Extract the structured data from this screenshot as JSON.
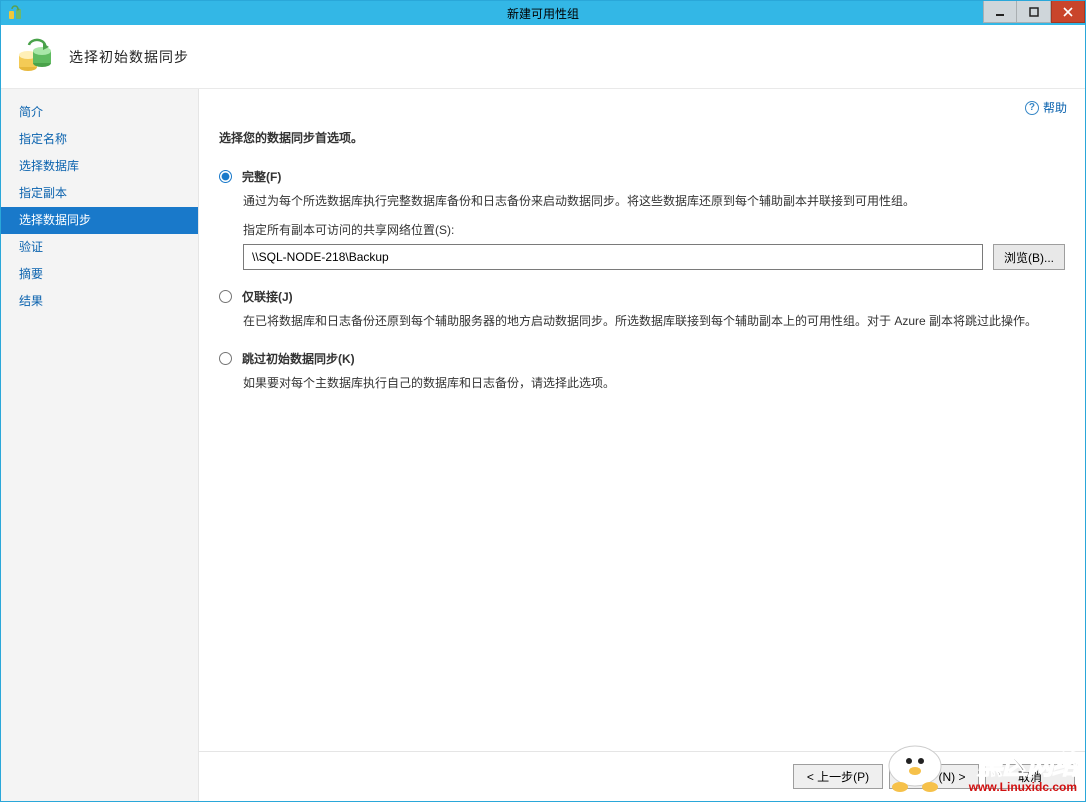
{
  "titlebar": {
    "title": "新建可用性组"
  },
  "header": {
    "title": "选择初始数据同步"
  },
  "sidebar": {
    "items": [
      {
        "label": "简介"
      },
      {
        "label": "指定名称"
      },
      {
        "label": "选择数据库"
      },
      {
        "label": "指定副本"
      },
      {
        "label": "选择数据同步"
      },
      {
        "label": "验证"
      },
      {
        "label": "摘要"
      },
      {
        "label": "结果"
      }
    ],
    "active_index": 4
  },
  "main": {
    "help_label": "帮助",
    "instruction": "选择您的数据同步首选项。",
    "option_full": {
      "label": "完整(F)",
      "description": "通过为每个所选数据库执行完整数据库备份和日志备份来启动数据同步。将这些数据库还原到每个辅助副本并联接到可用性组。",
      "share_label": "指定所有副本可访问的共享网络位置(S):",
      "share_value": "\\\\SQL-NODE-218\\Backup",
      "browse_label": "浏览(B)..."
    },
    "option_join": {
      "label": "仅联接(J)",
      "description": "在已将数据库和日志备份还原到每个辅助服务器的地方启动数据同步。所选数据库联接到每个辅助副本上的可用性组。对于 Azure 副本将跳过此操作。"
    },
    "option_skip": {
      "label": "跳过初始数据同步(K)",
      "description": "如果要对每个主数据库执行自己的数据库和日志备份，请选择此选项。"
    }
  },
  "footer": {
    "prev": "< 上一步(P)",
    "next": "下一步(N) >",
    "cancel": "取消"
  },
  "watermark": {
    "name": "黑区网络",
    "url": "www.Linuxidc.com"
  }
}
